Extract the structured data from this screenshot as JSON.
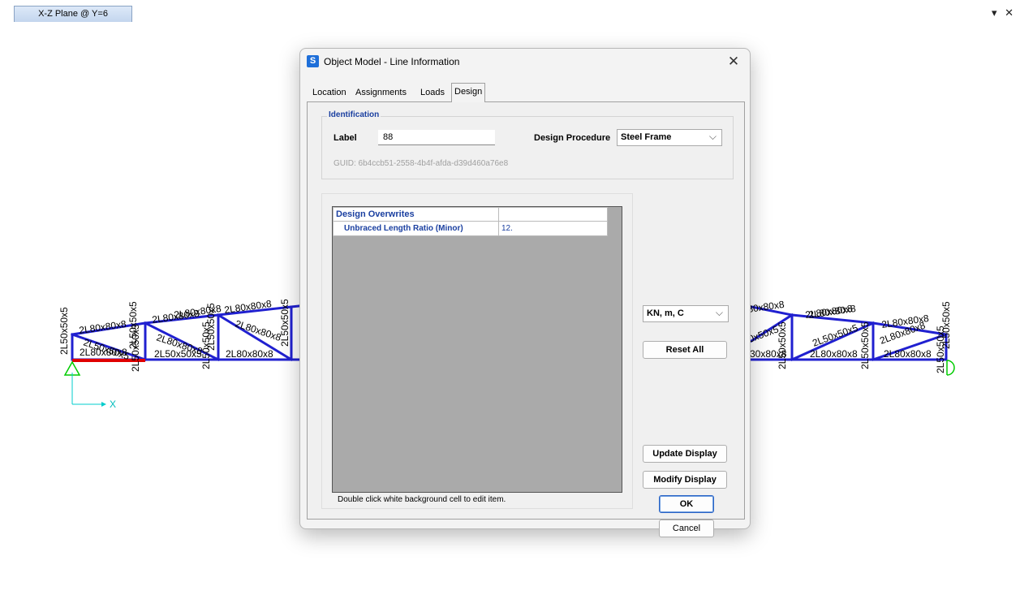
{
  "view": {
    "tab_label": "X-Z Plane @ Y=6",
    "dropdown_glyph": "▾",
    "close_glyph": "✕"
  },
  "model": {
    "axis_label": "X",
    "colors": {
      "frame": "#2020d0",
      "selected": "#e00000",
      "support": "#00cc00",
      "label": "#000000"
    },
    "labels": [
      "2L50x50x5",
      "2L80x80x8",
      "2L50x50x5",
      "2L80x80x8",
      "2L80x80x8",
      "2L50x50x5",
      "2L50x50x5",
      "2L80x80x8",
      "2L50x50x5",
      "2L80x80x8",
      "2L80x80x8",
      "2L50x50x5",
      "2L50x50x5",
      "2L80x80x8",
      "2L50x50x5",
      "2L80x80x8",
      "30x80x8",
      "0x50x5",
      "30x80x8",
      "2L80x80x8",
      "2L50x50x5",
      "2L80x80x8",
      "2L50x50x5",
      "2L80x80x8",
      "2L50x50x5",
      "2L80x80x8",
      "2L50x50x5",
      "2L80x80x8",
      "2L80x80x8",
      "2L50x50x5"
    ]
  },
  "dialog": {
    "app_icon": "S",
    "title": "Object Model - Line Information",
    "close_glyph": "✕",
    "tabs": [
      "Location",
      "Assignments",
      "Loads",
      "Design"
    ],
    "active_tab": "Design",
    "identification": {
      "legend": "Identification",
      "label_caption": "Label",
      "label_value": "88",
      "procedure_caption": "Design Procedure",
      "procedure_value": "Steel Frame",
      "guid": "GUID:  6b4ccb51-2558-4b4f-afda-d39d460a76e8"
    },
    "overwrites": {
      "header": "Design Overwrites",
      "rows": [
        {
          "name": "Unbraced Length Ratio (Minor)",
          "value": "12."
        }
      ],
      "hint": "Double click white background cell to edit item."
    },
    "units": {
      "value": "KN, m, C"
    },
    "buttons": {
      "reset_all": "Reset All",
      "update_display": "Update Display",
      "modify_display": "Modify Display",
      "ok": "OK",
      "cancel": "Cancel"
    },
    "chevron_glyph": "⌵"
  }
}
